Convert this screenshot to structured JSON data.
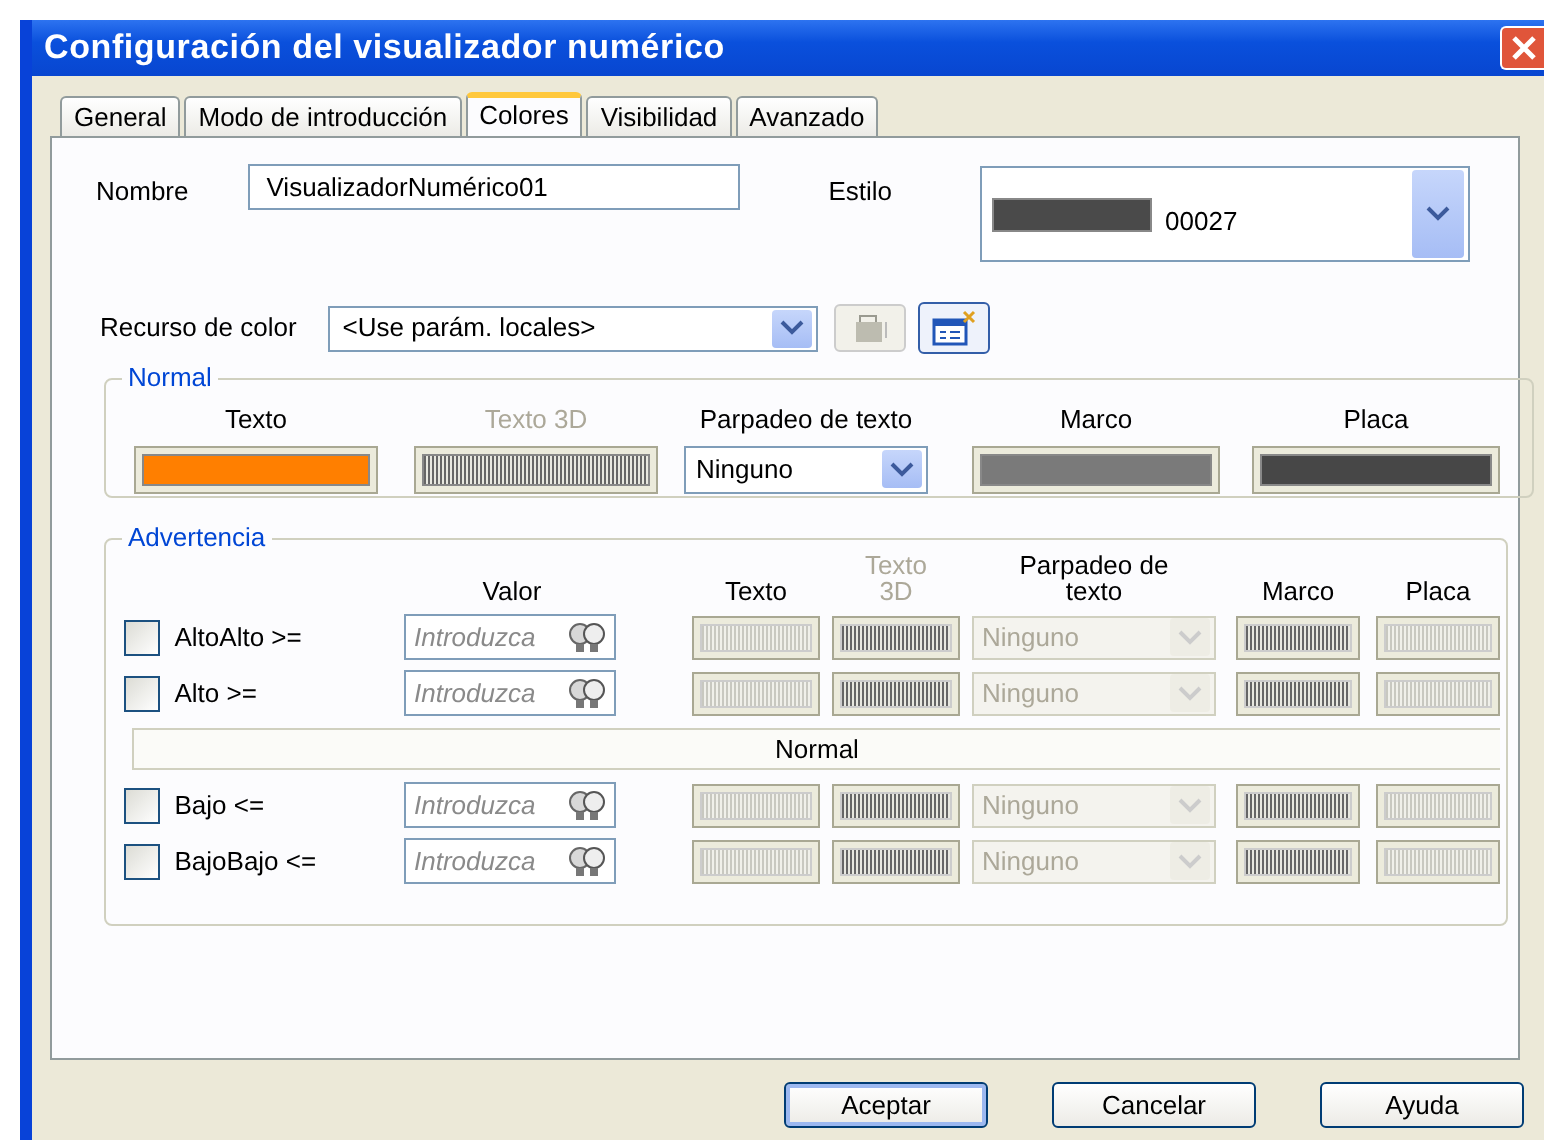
{
  "window": {
    "title": "Configuración del visualizador numérico"
  },
  "tabs": [
    {
      "label": "General",
      "selected": false
    },
    {
      "label": "Modo de introducción",
      "selected": false
    },
    {
      "label": "Colores",
      "selected": true
    },
    {
      "label": "Visibilidad",
      "selected": false
    },
    {
      "label": "Avanzado",
      "selected": false
    }
  ],
  "nombre": {
    "label": "Nombre",
    "value": "VisualizadorNumérico01"
  },
  "estilo": {
    "label": "Estilo",
    "color": "#4a4a4a",
    "value": "00027"
  },
  "recurso": {
    "label": "Recurso de color",
    "value": "<Use parám. locales>"
  },
  "normal": {
    "title": "Normal",
    "columns": [
      {
        "label": "Texto",
        "kind": "swatch",
        "disabled": false,
        "color": "#ff7f00"
      },
      {
        "label": "Texto 3D",
        "kind": "swatch",
        "disabled": true
      },
      {
        "label": "Parpadeo de texto",
        "kind": "dropdown",
        "disabled": false,
        "value": "Ninguno"
      },
      {
        "label": "Marco",
        "kind": "swatch",
        "disabled": false,
        "color": "#7a7a7a"
      },
      {
        "label": "Placa",
        "kind": "swatch",
        "disabled": false,
        "color": "#474747"
      }
    ]
  },
  "advertencia": {
    "title": "Advertencia",
    "headers": [
      {
        "label": "Valor",
        "disabled": false
      },
      {
        "label": "Texto",
        "disabled": false
      },
      {
        "label": "Texto 3D",
        "disabled": true
      },
      {
        "label": "Parpadeo de texto",
        "disabled": false
      },
      {
        "label": "Marco",
        "disabled": false
      },
      {
        "label": "Placa",
        "disabled": false
      }
    ],
    "rows": [
      {
        "kind": "level",
        "label": "AltoAlto >=",
        "checked": false,
        "placeholder": "Introduzca",
        "blink": "Ninguno"
      },
      {
        "kind": "level",
        "label": "Alto >=",
        "checked": false,
        "placeholder": "Introduzca",
        "blink": "Ninguno"
      },
      {
        "kind": "divider",
        "label": "Normal"
      },
      {
        "kind": "level",
        "label": "Bajo <=",
        "checked": false,
        "placeholder": "Introduzca",
        "blink": "Ninguno"
      },
      {
        "kind": "level",
        "label": "BajoBajo <=",
        "checked": false,
        "placeholder": "Introduzca",
        "blink": "Ninguno"
      }
    ]
  },
  "buttons": [
    {
      "label": "Aceptar",
      "default": true
    },
    {
      "label": "Cancelar",
      "default": false
    },
    {
      "label": "Ayuda",
      "default": false
    }
  ]
}
